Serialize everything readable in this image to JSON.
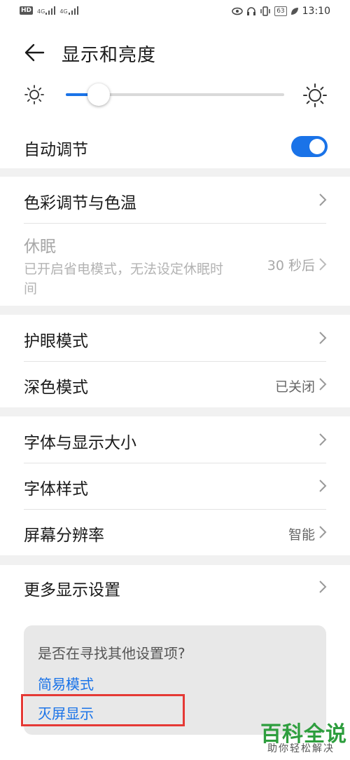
{
  "status_bar": {
    "hd_badge": "HD",
    "signal_1": "4G",
    "signal_2": "4G",
    "battery": "63",
    "time": "13:10"
  },
  "header": {
    "title": "显示和亮度"
  },
  "brightness": {
    "level": 0.15
  },
  "auto_adjust": {
    "label": "自动调节",
    "enabled": true
  },
  "sections": {
    "color": {
      "label": "色彩调节与色温"
    },
    "sleep": {
      "label": "休眠",
      "description": "已开启省电模式，无法设定休眠时间",
      "value": "30 秒后"
    },
    "eye_comfort": {
      "label": "护眼模式"
    },
    "dark_mode": {
      "label": "深色模式",
      "value": "已关闭"
    },
    "font_size": {
      "label": "字体与显示大小"
    },
    "font_style": {
      "label": "字体样式"
    },
    "resolution": {
      "label": "屏幕分辨率",
      "value": "智能"
    },
    "more": {
      "label": "更多显示设置"
    }
  },
  "suggestions": {
    "question": "是否在寻找其他设置项?",
    "links": [
      "简易模式",
      "灭屏显示"
    ]
  },
  "watermark": {
    "title": "百科全说",
    "subtitle": "助你轻松解决"
  },
  "colors": {
    "accent": "#1a73e8",
    "highlight": "#e53935",
    "watermark": "#2e9e3e"
  }
}
